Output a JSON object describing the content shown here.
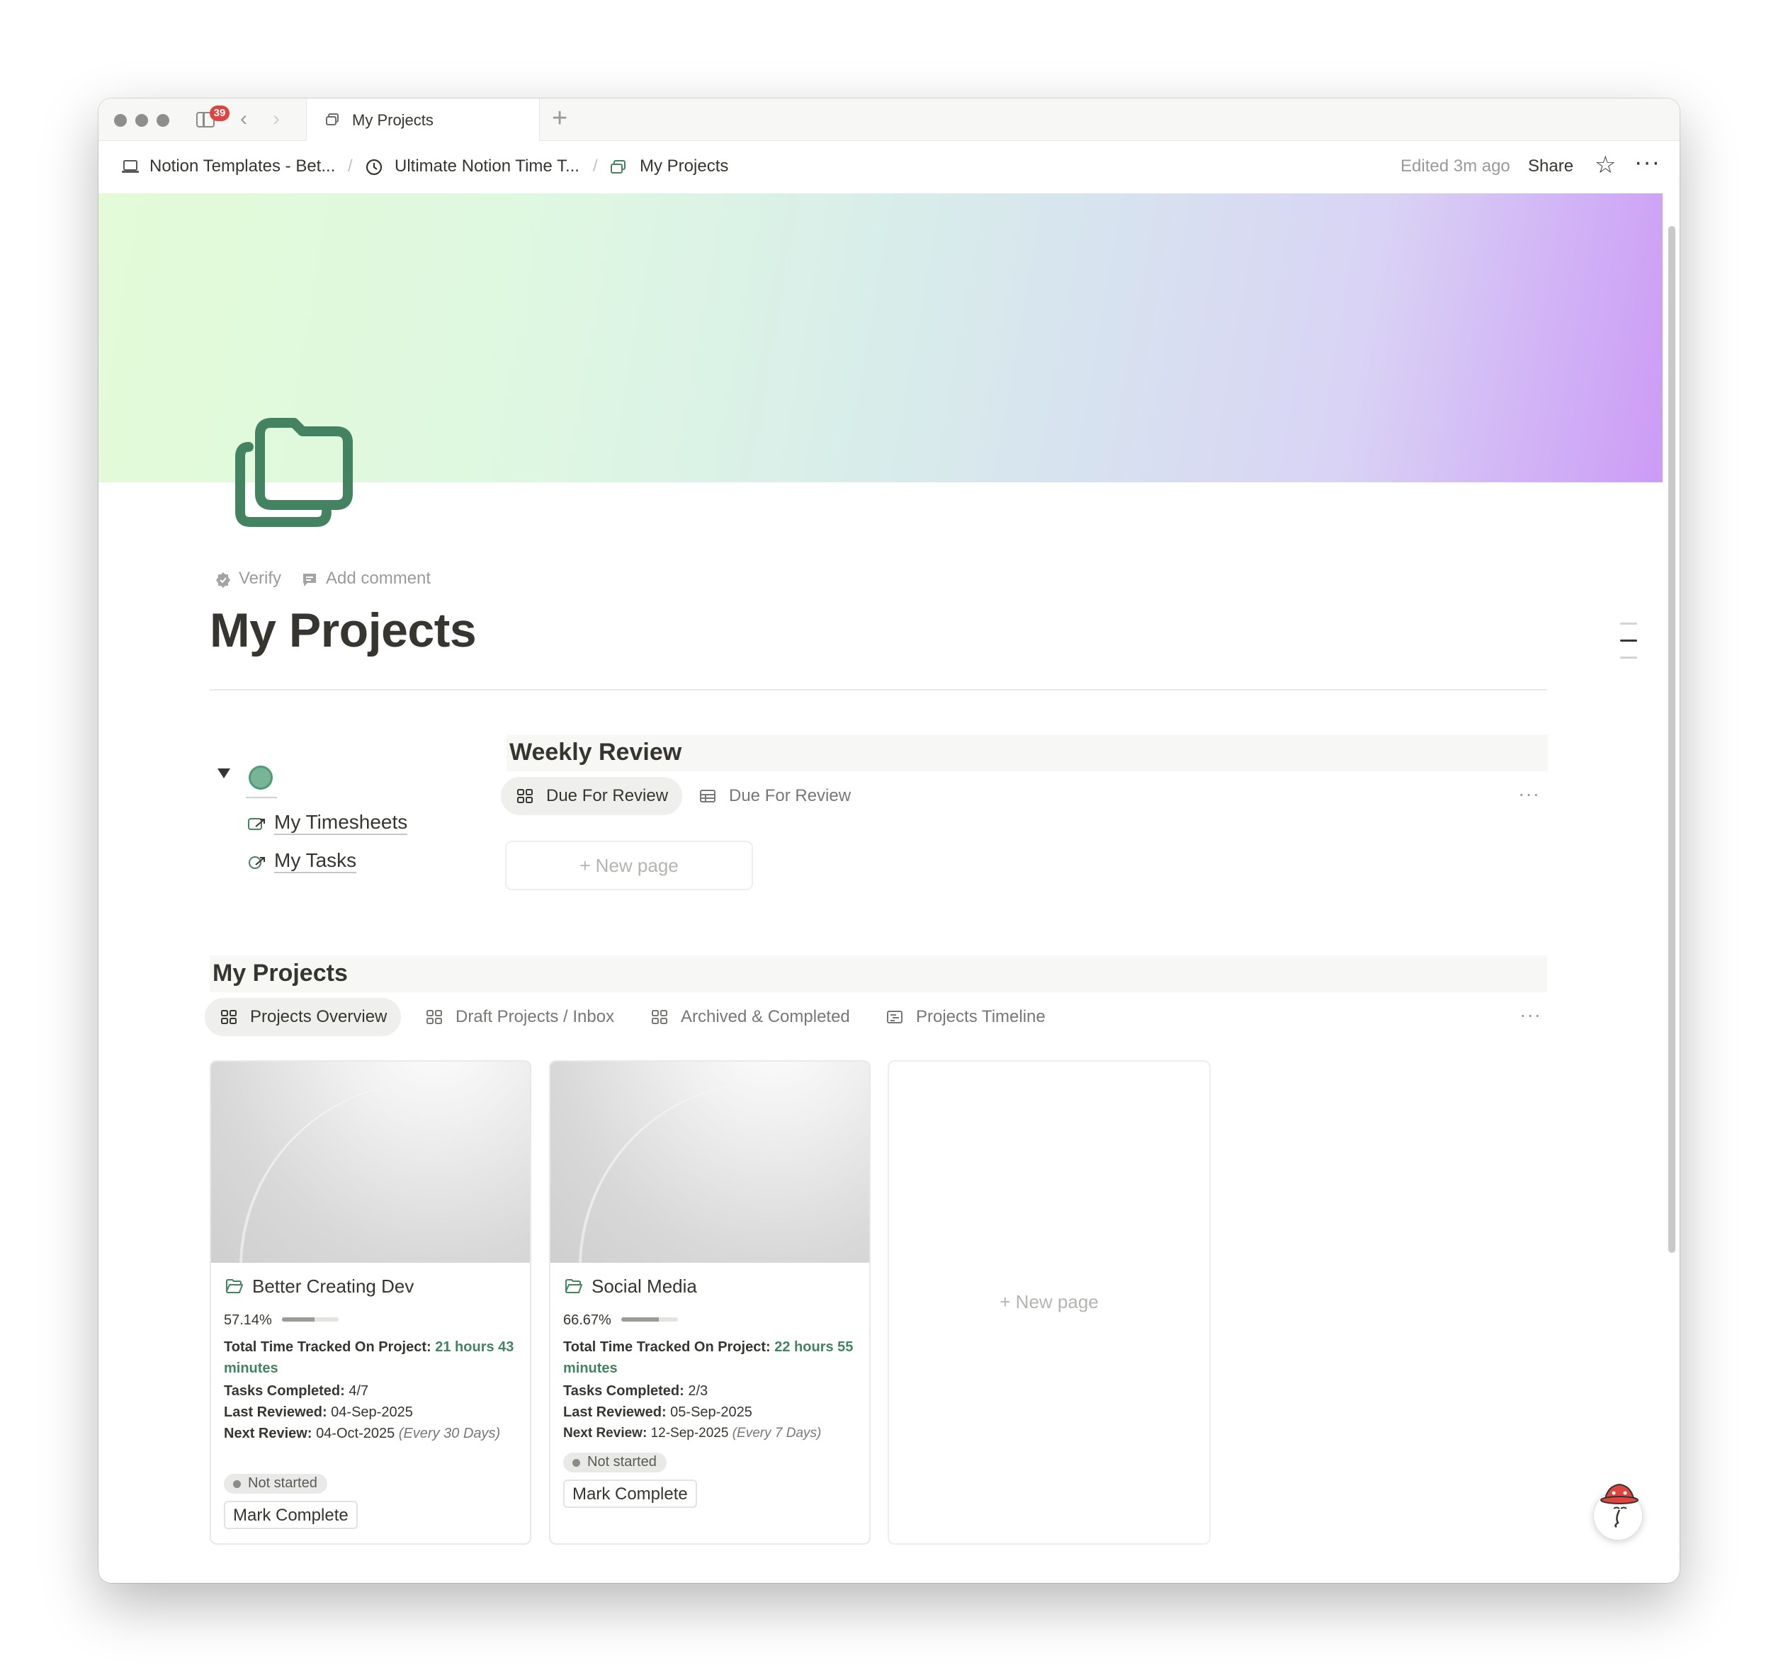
{
  "tabbar": {
    "notification_count": "39",
    "tab_title": "My Projects",
    "new_tab_symbol": "+"
  },
  "breadcrumb": {
    "items": [
      {
        "label": "Notion Templates - Bet...",
        "icon": "laptop-icon"
      },
      {
        "label": "Ultimate Notion Time T...",
        "icon": "clock-icon"
      },
      {
        "label": "My Projects",
        "icon": "folders-icon"
      }
    ],
    "separator": "/",
    "edited": "Edited 3m ago",
    "share": "Share",
    "more": "···"
  },
  "page": {
    "title": "My Projects",
    "verify": "Verify",
    "add_comment": "Add comment",
    "icon": "folders-icon",
    "icon_color": "#448361"
  },
  "links": [
    {
      "label": "My Timesheets",
      "icon": "linked-page-icon"
    },
    {
      "label": "My Tasks",
      "icon": "linked-page-icon"
    }
  ],
  "weekly_review": {
    "title": "Weekly Review",
    "views": [
      {
        "label": "Due For Review",
        "icon": "gallery-icon",
        "active": true
      },
      {
        "label": "Due For Review",
        "icon": "table-icon",
        "active": false
      }
    ],
    "new_page": "New page"
  },
  "projects": {
    "title": "My Projects",
    "views": [
      {
        "label": "Projects Overview",
        "icon": "gallery-icon",
        "active": true
      },
      {
        "label": "Draft Projects / Inbox",
        "icon": "gallery-icon",
        "active": false
      },
      {
        "label": "Archived & Completed",
        "icon": "gallery-icon",
        "active": false
      },
      {
        "label": "Projects Timeline",
        "icon": "timeline-icon",
        "active": false
      }
    ],
    "new_page": "New page",
    "cards": [
      {
        "title": "Better Creating Dev",
        "progress": "57.14%",
        "progress_value": 0.5714,
        "time_label": "Total Time Tracked On Project:",
        "time_value": "21 hours 43 minutes",
        "tasks_label": "Tasks Completed:",
        "tasks_value": "4/7",
        "last_label": "Last Reviewed:",
        "last_value": "04-Sep-2025",
        "next_label": "Next Review:",
        "next_value": "04-Oct-2025",
        "next_note": "(Every 30 Days)",
        "status": "Not started",
        "button": "Mark Complete"
      },
      {
        "title": "Social Media",
        "progress": "66.67%",
        "progress_value": 0.6667,
        "time_label": "Total Time Tracked On Project:",
        "time_value": "22 hours 55 minutes",
        "tasks_label": "Tasks Completed:",
        "tasks_value": "2/3",
        "last_label": "Last Reviewed:",
        "last_value": "05-Sep-2025",
        "next_label": "Next Review:",
        "next_value": "12-Sep-2025",
        "next_note": "(Every 7 Days)",
        "status": "Not started",
        "button": "Mark Complete"
      }
    ]
  },
  "colors": {
    "accent_green": "#448361",
    "badge_red": "#e0443e"
  }
}
